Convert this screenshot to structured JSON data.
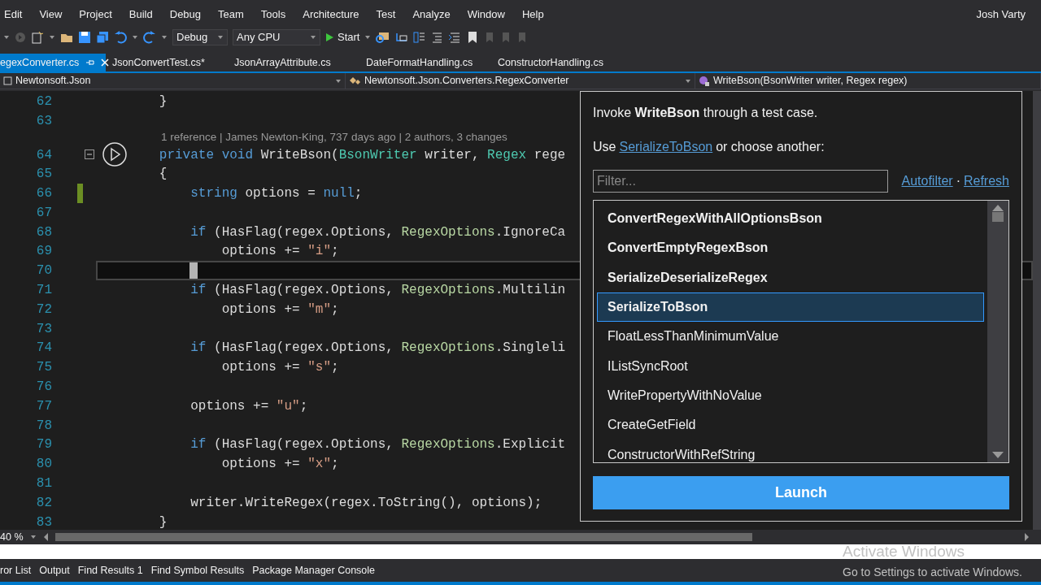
{
  "menu": [
    "Edit",
    "View",
    "Project",
    "Build",
    "Debug",
    "Team",
    "Tools",
    "Architecture",
    "Test",
    "Analyze",
    "Window",
    "Help"
  ],
  "user": "Josh Varty",
  "toolbar": {
    "configuration": "Debug",
    "platform": "Any CPU",
    "start": "Start"
  },
  "tabs": [
    {
      "label": "egexConverter.cs",
      "selected": true
    },
    {
      "label": "JsonConvertTest.cs*",
      "selected": false
    },
    {
      "label": "JsonArrayAttribute.cs",
      "selected": false
    },
    {
      "label": "DateFormatHandling.cs",
      "selected": false
    },
    {
      "label": "ConstructorHandling.cs",
      "selected": false
    }
  ],
  "navigation": {
    "project": "Newtonsoft.Json",
    "type": "Newtonsoft.Json.Converters.RegexConverter",
    "member": "WriteBson(BsonWriter writer, Regex regex)"
  },
  "editor": {
    "lines": [
      {
        "kind": "code",
        "number": "62",
        "changed": false,
        "current": false,
        "foldable": false,
        "tokens": [
          {
            "kind": "plain",
            "text": "        }"
          }
        ]
      },
      {
        "kind": "code",
        "number": "63",
        "changed": false,
        "current": false,
        "foldable": false
      },
      {
        "kind": "lens",
        "text": "1 reference | James Newton-King, 737 days ago | 2 authors, 3 changes"
      },
      {
        "kind": "code",
        "number": "64",
        "changed": false,
        "current": false,
        "foldable": true,
        "tokens": [
          {
            "kind": "keyword",
            "text": "        private void "
          },
          {
            "kind": "plain",
            "text": "WriteBson("
          },
          {
            "kind": "type",
            "text": "BsonWriter"
          },
          {
            "kind": "plain",
            "text": " writer, "
          },
          {
            "kind": "type",
            "text": "Regex"
          },
          {
            "kind": "plain",
            "text": " rege"
          }
        ]
      },
      {
        "kind": "code",
        "number": "65",
        "changed": false,
        "current": false,
        "foldable": false,
        "tokens": [
          {
            "kind": "plain",
            "text": "        {"
          }
        ]
      },
      {
        "kind": "code",
        "number": "66",
        "changed": true,
        "current": false,
        "foldable": false,
        "tokens": [
          {
            "kind": "keyword",
            "text": "            string"
          },
          {
            "kind": "plain",
            "text": " options = "
          },
          {
            "kind": "keyword",
            "text": "null"
          },
          {
            "kind": "plain",
            "text": ";"
          }
        ]
      },
      {
        "kind": "code",
        "number": "67",
        "changed": false,
        "current": false,
        "foldable": false
      },
      {
        "kind": "code",
        "number": "68",
        "changed": false,
        "current": false,
        "foldable": false,
        "tokens": [
          {
            "kind": "keyword",
            "text": "            if"
          },
          {
            "kind": "plain",
            "text": " (HasFlag(regex.Options, "
          },
          {
            "kind": "enum",
            "text": "RegexOptions"
          },
          {
            "kind": "plain",
            "text": ".IgnoreCa"
          }
        ]
      },
      {
        "kind": "code",
        "number": "69",
        "changed": false,
        "current": false,
        "foldable": false,
        "tokens": [
          {
            "kind": "plain",
            "text": "                options += "
          },
          {
            "kind": "string",
            "text": "\"i\""
          },
          {
            "kind": "plain",
            "text": ";"
          }
        ]
      },
      {
        "kind": "code",
        "number": "70",
        "changed": false,
        "current": true,
        "foldable": false
      },
      {
        "kind": "code",
        "number": "71",
        "changed": false,
        "current": false,
        "foldable": false,
        "tokens": [
          {
            "kind": "keyword",
            "text": "            if"
          },
          {
            "kind": "plain",
            "text": " (HasFlag(regex.Options, "
          },
          {
            "kind": "enum",
            "text": "RegexOptions"
          },
          {
            "kind": "plain",
            "text": ".Multilin"
          }
        ]
      },
      {
        "kind": "code",
        "number": "72",
        "changed": false,
        "current": false,
        "foldable": false,
        "tokens": [
          {
            "kind": "plain",
            "text": "                options += "
          },
          {
            "kind": "string",
            "text": "\"m\""
          },
          {
            "kind": "plain",
            "text": ";"
          }
        ]
      },
      {
        "kind": "code",
        "number": "73",
        "changed": false,
        "current": false,
        "foldable": false
      },
      {
        "kind": "code",
        "number": "74",
        "changed": false,
        "current": false,
        "foldable": false,
        "tokens": [
          {
            "kind": "keyword",
            "text": "            if"
          },
          {
            "kind": "plain",
            "text": " (HasFlag(regex.Options, "
          },
          {
            "kind": "enum",
            "text": "RegexOptions"
          },
          {
            "kind": "plain",
            "text": ".Singleli"
          }
        ]
      },
      {
        "kind": "code",
        "number": "75",
        "changed": false,
        "current": false,
        "foldable": false,
        "tokens": [
          {
            "kind": "plain",
            "text": "                options += "
          },
          {
            "kind": "string",
            "text": "\"s\""
          },
          {
            "kind": "plain",
            "text": ";"
          }
        ]
      },
      {
        "kind": "code",
        "number": "76",
        "changed": false,
        "current": false,
        "foldable": false
      },
      {
        "kind": "code",
        "number": "77",
        "changed": false,
        "current": false,
        "foldable": false,
        "tokens": [
          {
            "kind": "plain",
            "text": "            options += "
          },
          {
            "kind": "string",
            "text": "\"u\""
          },
          {
            "kind": "plain",
            "text": ";"
          }
        ]
      },
      {
        "kind": "code",
        "number": "78",
        "changed": false,
        "current": false,
        "foldable": false
      },
      {
        "kind": "code",
        "number": "79",
        "changed": false,
        "current": false,
        "foldable": false,
        "tokens": [
          {
            "kind": "keyword",
            "text": "            if"
          },
          {
            "kind": "plain",
            "text": " (HasFlag(regex.Options, "
          },
          {
            "kind": "enum",
            "text": "RegexOptions"
          },
          {
            "kind": "plain",
            "text": ".Explicit"
          }
        ]
      },
      {
        "kind": "code",
        "number": "80",
        "changed": false,
        "current": false,
        "foldable": false,
        "tokens": [
          {
            "kind": "plain",
            "text": "                options += "
          },
          {
            "kind": "string",
            "text": "\"x\""
          },
          {
            "kind": "plain",
            "text": ";"
          }
        ]
      },
      {
        "kind": "code",
        "number": "81",
        "changed": false,
        "current": false,
        "foldable": false
      },
      {
        "kind": "code",
        "number": "82",
        "changed": false,
        "current": false,
        "foldable": false,
        "tokens": [
          {
            "kind": "plain",
            "text": "            writer.WriteRegex(regex.ToString(), options);"
          }
        ]
      },
      {
        "kind": "code",
        "number": "83",
        "changed": false,
        "current": false,
        "foldable": false,
        "tokens": [
          {
            "kind": "plain",
            "text": "        }"
          }
        ]
      }
    ],
    "zoom": "40 %"
  },
  "popup": {
    "intro": "Invoke **WriteBson** through a test case.",
    "use_prefix": "Use",
    "use_link": "SerializeToBson",
    "use_suffix": "or choose another:",
    "filter": {
      "placeholder": "Filter..."
    },
    "autofilter": "Autofilter",
    "separator": "·",
    "refresh": "Refresh",
    "tests": [
      {
        "label": "ConvertRegexWithAllOptionsBson",
        "bold": true,
        "selected": false
      },
      {
        "label": "ConvertEmptyRegexBson",
        "bold": true,
        "selected": false
      },
      {
        "label": "SerializeDeserializeRegex",
        "bold": true,
        "selected": false
      },
      {
        "label": "SerializeToBson",
        "bold": true,
        "selected": true
      },
      {
        "label": "FloatLessThanMinimumValue",
        "bold": false,
        "selected": false
      },
      {
        "label": "IListSyncRoot",
        "bold": false,
        "selected": false
      },
      {
        "label": "WritePropertyWithNoValue",
        "bold": false,
        "selected": false
      },
      {
        "label": "CreateGetField",
        "bold": false,
        "selected": false
      },
      {
        "label": "ConstructorWithRefString",
        "bold": false,
        "selected": false
      }
    ],
    "launch": "Launch"
  },
  "bottom_tabs": [
    "ror List",
    "Output",
    "Find Results 1",
    "Find Symbol Results",
    "Package Manager Console"
  ],
  "activation": {
    "title": "Activate Windows",
    "message": "Go to Settings to activate Windows."
  }
}
